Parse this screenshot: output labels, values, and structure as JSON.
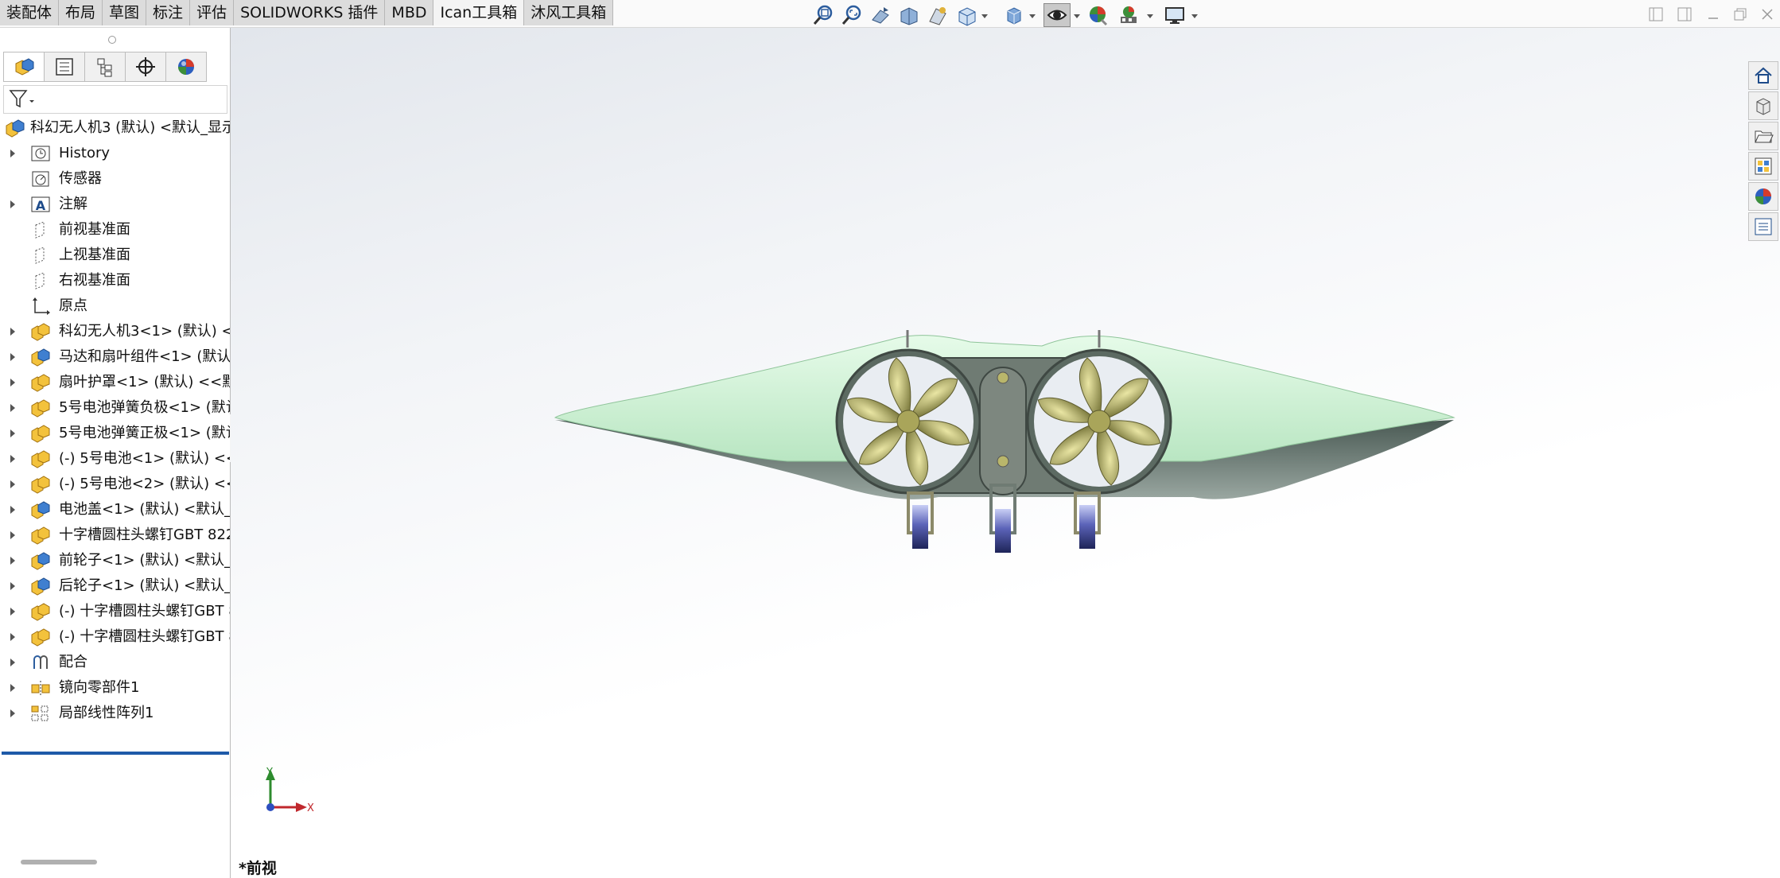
{
  "tabs": [
    {
      "label": "装配体",
      "active": false
    },
    {
      "label": "布局",
      "active": false
    },
    {
      "label": "草图",
      "active": false
    },
    {
      "label": "标注",
      "active": false
    },
    {
      "label": "评估",
      "active": false
    },
    {
      "label": "SOLIDWORKS 插件",
      "active": false
    },
    {
      "label": "MBD",
      "active": false
    },
    {
      "label": "Ican工具箱",
      "active": true
    },
    {
      "label": "沐风工具箱",
      "active": false
    }
  ],
  "view_toolbar": [
    "zoom-to-fit-icon",
    "zoom-to-area-icon",
    "previous-view-icon",
    "section-view-icon",
    "dynamic-annotation-icon",
    "view-orientation-icon",
    "display-style-icon",
    "hide-show-items-icon",
    "edit-appearance-icon",
    "apply-scene-icon",
    "view-settings-icon"
  ],
  "feature_tree": {
    "root": "科幻无人机3 (默认) <默认_显示",
    "items": [
      {
        "label": "History",
        "expandable": true,
        "icon": "history-icon"
      },
      {
        "label": "传感器",
        "expandable": false,
        "icon": "sensor-icon"
      },
      {
        "label": "注解",
        "expandable": true,
        "icon": "annotation-icon"
      },
      {
        "label": "前视基准面",
        "expandable": false,
        "icon": "plane-icon"
      },
      {
        "label": "上视基准面",
        "expandable": false,
        "icon": "plane-icon"
      },
      {
        "label": "右视基准面",
        "expandable": false,
        "icon": "plane-icon"
      },
      {
        "label": "原点",
        "expandable": false,
        "icon": "origin-icon"
      },
      {
        "label": "科幻无人机3<1> (默认) <<",
        "expandable": true,
        "icon": "subassembly-icon"
      },
      {
        "label": "马达和扇叶组件<1> (默认)",
        "expandable": true,
        "icon": "part-icon"
      },
      {
        "label": "扇叶护罩<1> (默认) <<默",
        "expandable": true,
        "icon": "subassembly-icon"
      },
      {
        "label": "5号电池弹簧负极<1> (默认",
        "expandable": true,
        "icon": "subassembly-icon"
      },
      {
        "label": "5号电池弹簧正极<1> (默认",
        "expandable": true,
        "icon": "subassembly-icon"
      },
      {
        "label": "(-) 5号电池<1> (默认) <<!",
        "expandable": true,
        "icon": "subassembly-icon"
      },
      {
        "label": "(-) 5号电池<2> (默认) <<!",
        "expandable": true,
        "icon": "subassembly-icon"
      },
      {
        "label": "电池盖<1> (默认) <默认_显",
        "expandable": true,
        "icon": "part-icon"
      },
      {
        "label": "十字槽圆柱头螺钉GBT 822",
        "expandable": true,
        "icon": "subassembly-icon"
      },
      {
        "label": "前轮子<1> (默认) <默认_显",
        "expandable": true,
        "icon": "part-icon"
      },
      {
        "label": "后轮子<1> (默认) <默认_显",
        "expandable": true,
        "icon": "part-icon"
      },
      {
        "label": "(-) 十字槽圆柱头螺钉GBT 8",
        "expandable": true,
        "icon": "subassembly-icon"
      },
      {
        "label": "(-) 十字槽圆柱头螺钉GBT 8",
        "expandable": true,
        "icon": "subassembly-icon"
      },
      {
        "label": "配合",
        "expandable": true,
        "icon": "mates-icon"
      },
      {
        "label": "镜向零部件1",
        "expandable": true,
        "icon": "mirror-icon"
      },
      {
        "label": "局部线性阵列1",
        "expandable": true,
        "icon": "pattern-icon"
      }
    ]
  },
  "panel_tabs": [
    "featuremanager-icon",
    "propertymanager-icon",
    "configurationmanager-icon",
    "dimxpert-icon",
    "displaymanager-icon"
  ],
  "task_pane": [
    "home-icon",
    "design-library-icon",
    "file-explorer-icon",
    "view-palette-icon",
    "appearances-icon",
    "custom-properties-icon"
  ],
  "viewport": {
    "view_name": "*前视",
    "triad": {
      "y": "Y",
      "x": "X"
    }
  },
  "colors": {
    "wing": "#d8f5dc",
    "hull": "#6f7b73",
    "blade": "#b7b36a",
    "wheel": "#2a2f6e"
  }
}
